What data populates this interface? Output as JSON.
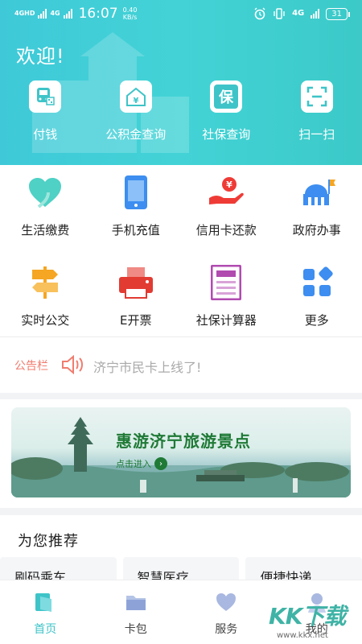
{
  "status_bar": {
    "network1": "4GHD",
    "network2": "4G",
    "time": "16:07",
    "speed_value": "0.40",
    "speed_unit": "KB/s",
    "signal_right": "4G",
    "battery": "31"
  },
  "header": {
    "welcome": "欢迎!",
    "actions": [
      {
        "label": "付钱",
        "icon": "bus-qr-icon"
      },
      {
        "label": "公积金查询",
        "icon": "house-yuan-icon"
      },
      {
        "label": "社保查询",
        "icon": "bao-character-icon"
      },
      {
        "label": "扫一扫",
        "icon": "scan-icon"
      }
    ]
  },
  "services": [
    {
      "label": "生活缴费",
      "icon": "heart-icon",
      "color": "#4fd1c5"
    },
    {
      "label": "手机充值",
      "icon": "phone-icon",
      "color": "#3d8ef0"
    },
    {
      "label": "信用卡还款",
      "icon": "hand-yuan-icon",
      "color": "#ef3b36"
    },
    {
      "label": "政府办事",
      "icon": "government-building-icon",
      "color": "#3d8ef0"
    },
    {
      "label": "实时公交",
      "icon": "signpost-icon",
      "color": "#f5a623"
    },
    {
      "label": "E开票",
      "icon": "printer-icon",
      "color": "#e23b32"
    },
    {
      "label": "社保计算器",
      "icon": "calculator-icon",
      "color": "#b14bb0"
    },
    {
      "label": "更多",
      "icon": "grid-icon",
      "color": "#3d8ef0"
    }
  ],
  "notice": {
    "title": "公告栏",
    "text": "济宁市民卡上线了!"
  },
  "banner": {
    "title": "惠游济宁旅游景点",
    "cta": "点击进入"
  },
  "recommend": {
    "title": "为您推荐",
    "cards": [
      "刷码乘车",
      "智慧医疗",
      "便捷快递"
    ]
  },
  "tabs": [
    {
      "label": "首页",
      "icon": "home-icon",
      "active": true
    },
    {
      "label": "卡包",
      "icon": "card-wallet-icon",
      "active": false
    },
    {
      "label": "服务",
      "icon": "service-heart-icon",
      "active": false
    },
    {
      "label": "我的",
      "icon": "profile-icon",
      "active": false
    }
  ],
  "watermark": {
    "text": "KK下载",
    "url": "www.kkx.net"
  },
  "colors": {
    "accent": "#3ec4c8",
    "notice": "#f07c6e",
    "banner_text": "#1f7a36"
  }
}
